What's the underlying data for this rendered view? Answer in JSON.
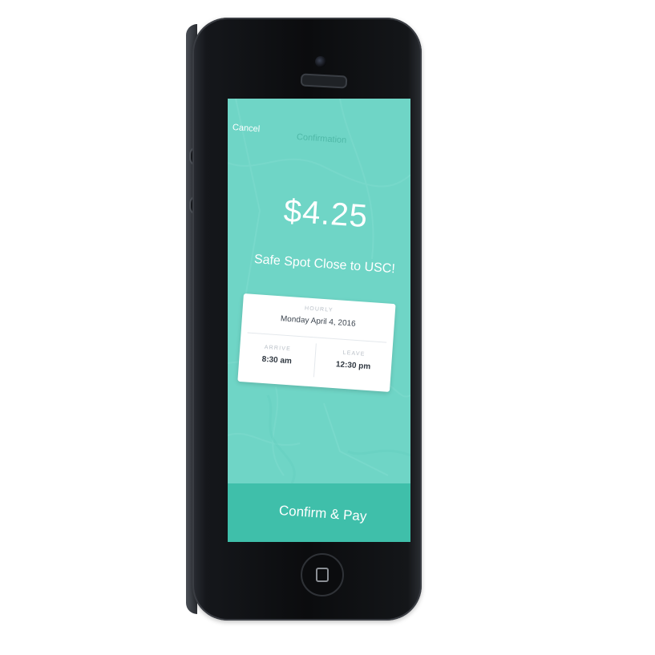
{
  "nav": {
    "cancel_label": "Cancel",
    "title": "Confirmation"
  },
  "booking": {
    "price": "$4.25",
    "spot_name": "Safe Spot Close to USC!",
    "rate_type": "HOURLY",
    "date": "Monday April 4, 2016",
    "arrive_label": "ARRIVE",
    "arrive_time": "8:30 am",
    "leave_label": "LEAVE",
    "leave_time": "12:30 pm"
  },
  "actions": {
    "confirm_label": "Confirm & Pay"
  },
  "colors": {
    "screen_bg": "#6fd5c6",
    "button_bg": "#3fbfaa",
    "nav_title": "#4fb8a7"
  }
}
